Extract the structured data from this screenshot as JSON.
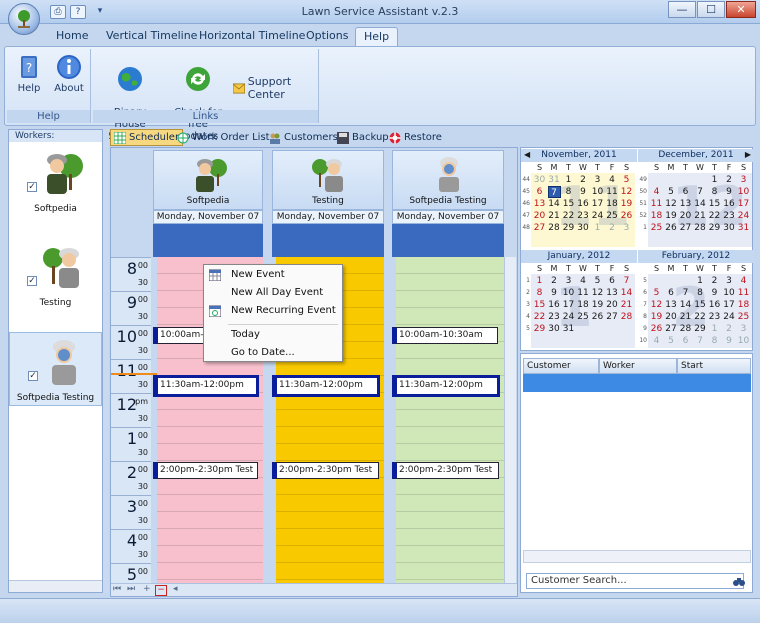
{
  "window": {
    "title": "Lawn Service Assistant v.2.3",
    "minimize": "—",
    "maximize": "☐",
    "close": "✕"
  },
  "quick_access": {
    "print": "⎙",
    "help": "?",
    "more": "▾"
  },
  "ribbon_tabs": [
    "Home",
    "Vertical Timeline",
    "Horizontal Timeline",
    "Options",
    "Help"
  ],
  "active_tab": "Help",
  "ribbon": {
    "help_group": {
      "label": "Help",
      "help_button": "Help",
      "about_button": "About"
    },
    "links_group": {
      "label": "Links",
      "binary_house": "Binary House\nSoftware",
      "check_updates": "Check for\nfree updates",
      "support_center": "Support Center"
    }
  },
  "workers_panel": {
    "header": "Workers:",
    "workers": [
      {
        "name": "Softpedia",
        "checked": true
      },
      {
        "name": "Testing",
        "checked": true
      },
      {
        "name": "Softpedia Testing",
        "checked": true
      }
    ]
  },
  "view_tabs": [
    "Scheduler",
    "Work Order List",
    "Customers",
    "Backup",
    "Restore"
  ],
  "scheduler": {
    "columns": [
      {
        "name": "Softpedia",
        "date": "Monday, November 07",
        "color": "#f7c0cc"
      },
      {
        "name": "Testing",
        "date": "Monday, November 07",
        "color": "#f9c900"
      },
      {
        "name": "Softpedia Testing",
        "date": "Monday, November 07",
        "color": "#d0e8b8"
      }
    ],
    "hours": [
      {
        "h": "8",
        "m": "00"
      },
      {
        "h": "9",
        "m": "00"
      },
      {
        "h": "10",
        "m": "00"
      },
      {
        "h": "11",
        "m": "00"
      },
      {
        "h": "12",
        "m": "pm"
      },
      {
        "h": "1",
        "m": "00"
      },
      {
        "h": "2",
        "m": "00"
      },
      {
        "h": "3",
        "m": "00"
      },
      {
        "h": "4",
        "m": "00"
      },
      {
        "h": "5",
        "m": "00"
      }
    ],
    "half_label": "30",
    "events": [
      {
        "label": "10:00am-10:30am"
      },
      {
        "label": "11:30am-12:00pm"
      },
      {
        "label": "2:00pm-2:30pm Test"
      }
    ]
  },
  "context_menu": {
    "items": [
      "New Event",
      "New All Day Event",
      "New Recurring Event",
      "Today",
      "Go to Date..."
    ]
  },
  "calendars": [
    {
      "title": "November, 2011",
      "weeks": [
        "44",
        "45",
        "46",
        "47",
        "48",
        "49"
      ],
      "days": [
        [
          "30",
          "31",
          "1",
          "2",
          "3",
          "4",
          "5"
        ],
        [
          "6",
          "7",
          "8",
          "9",
          "10",
          "11",
          "12"
        ],
        [
          "13",
          "14",
          "15",
          "16",
          "17",
          "18",
          "19"
        ],
        [
          "20",
          "21",
          "22",
          "23",
          "24",
          "25",
          "26"
        ],
        [
          "27",
          "28",
          "29",
          "30",
          "1",
          "2",
          "3"
        ]
      ],
      "nav": "◀"
    },
    {
      "title": "December, 2011",
      "weeks": [
        "49",
        "50",
        "51",
        "52",
        "1"
      ],
      "days": [
        [
          "",
          "",
          "",
          "",
          "1",
          "2",
          "3"
        ],
        [
          "4",
          "5",
          "6",
          "7",
          "8",
          "9",
          "10"
        ],
        [
          "11",
          "12",
          "13",
          "14",
          "15",
          "16",
          "17"
        ],
        [
          "18",
          "19",
          "20",
          "21",
          "22",
          "23",
          "24"
        ],
        [
          "25",
          "26",
          "27",
          "28",
          "29",
          "30",
          "31"
        ]
      ],
      "nav": "▶"
    },
    {
      "title": "January, 2012",
      "weeks": [
        "1",
        "2",
        "3",
        "4",
        "5",
        "6"
      ],
      "days": [
        [
          "1",
          "2",
          "3",
          "4",
          "5",
          "6",
          "7"
        ],
        [
          "8",
          "9",
          "10",
          "11",
          "12",
          "13",
          "14"
        ],
        [
          "15",
          "16",
          "17",
          "18",
          "19",
          "20",
          "21"
        ],
        [
          "22",
          "23",
          "24",
          "25",
          "26",
          "27",
          "28"
        ],
        [
          "29",
          "30",
          "31",
          "",
          "",
          "",
          ""
        ]
      ]
    },
    {
      "title": "February, 2012",
      "weeks": [
        "5",
        "6",
        "7",
        "8",
        "9",
        "10"
      ],
      "days": [
        [
          "",
          "",
          "",
          "1",
          "2",
          "3",
          "4"
        ],
        [
          "5",
          "6",
          "7",
          "8",
          "9",
          "10",
          "11"
        ],
        [
          "12",
          "13",
          "14",
          "15",
          "16",
          "17",
          "18"
        ],
        [
          "19",
          "20",
          "21",
          "22",
          "23",
          "24",
          "25"
        ],
        [
          "26",
          "27",
          "28",
          "29",
          "1",
          "2",
          "3"
        ],
        [
          "4",
          "5",
          "6",
          "7",
          "8",
          "9",
          "10"
        ]
      ]
    }
  ],
  "dow": [
    "S",
    "M",
    "T",
    "W",
    "T",
    "F",
    "S"
  ],
  "grid": {
    "headers": [
      "Customer",
      "Worker",
      "Start"
    ],
    "search_placeholder": "Customer Search..."
  }
}
